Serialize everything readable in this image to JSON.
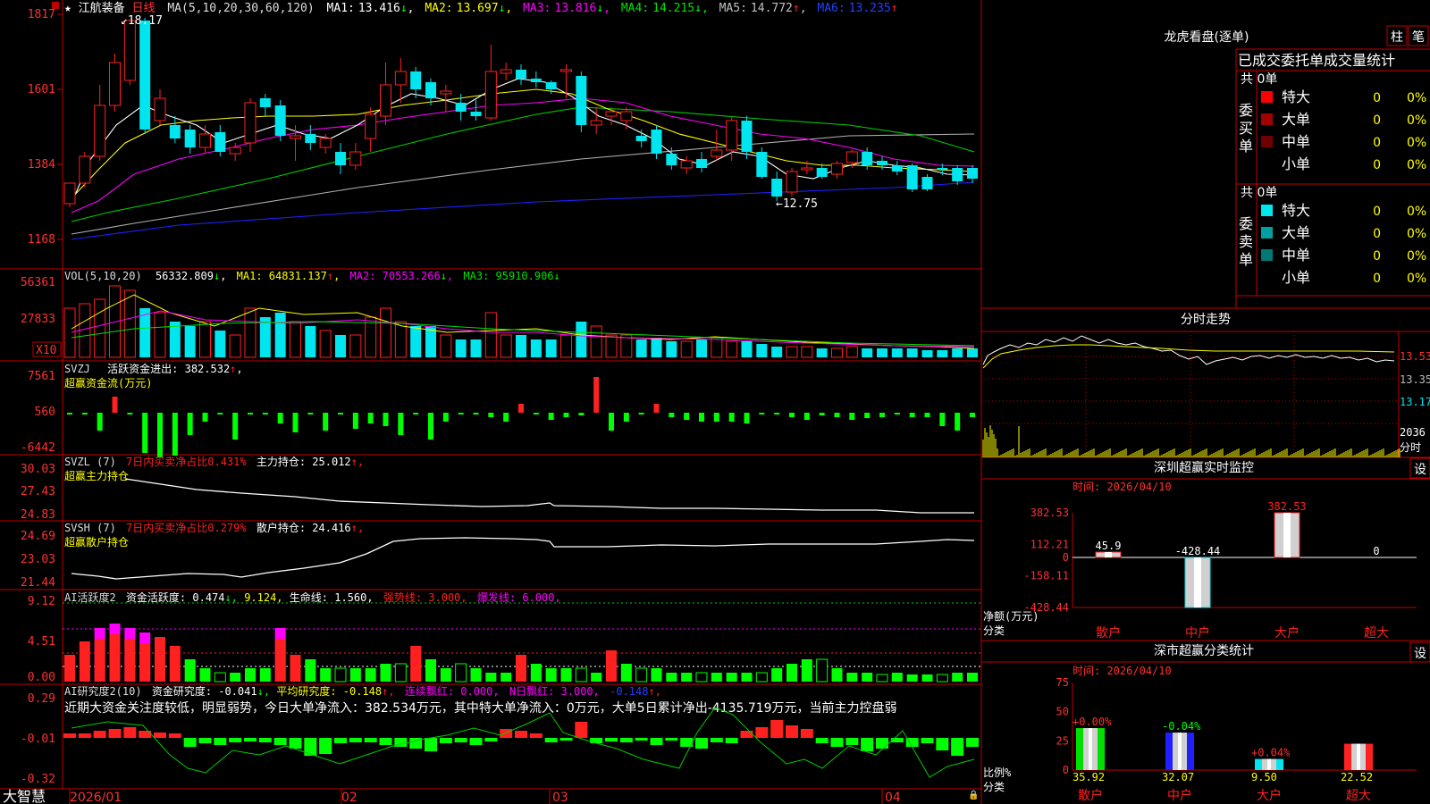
{
  "colors": {
    "up": "#ff2020",
    "down": "#00e5ee",
    "grid": "#c00000",
    "ma1": "#ffffff",
    "ma2": "#ffff00",
    "ma3": "#ff00ff",
    "ma4": "#00e000",
    "ma5": "#c0c0c0",
    "ma6": "#2020ff",
    "green": "#00ff00"
  },
  "stock": {
    "star": "★",
    "name": "江航装备",
    "period": "日线",
    "ma_params": "MA(5,10,20,30,60,120)",
    "ma": [
      {
        "label": "MA1:",
        "value": "13.416",
        "arrow": "↓"
      },
      {
        "label": "MA2:",
        "value": "13.697",
        "arrow": "↓"
      },
      {
        "label": "MA3:",
        "value": "13.816",
        "arrow": "↓"
      },
      {
        "label": "MA4:",
        "value": "14.215",
        "arrow": "↓"
      },
      {
        "label": "MA5:",
        "value": "14.772",
        "arrow": "↑"
      },
      {
        "label": "MA6:",
        "value": "13.235",
        "arrow": "↑"
      }
    ],
    "high_label": "18.17",
    "low_label": "12.75"
  },
  "price_axis": [
    "1817",
    "1601",
    "1384",
    "1168"
  ],
  "vol": {
    "title": "VOL(5,10,20)",
    "value": "56332.809",
    "arrow": "↓",
    "ma1": "MA1: 64831.137",
    "ma1_arrow": "↑",
    "ma2": "MA2: 70553.266",
    "ma2_arrow": "↓",
    "ma3": "MA3: 95910.906",
    "ma3_arrow": "↓",
    "axis": [
      "56361",
      "27833"
    ],
    "unit": "X10"
  },
  "svzj": {
    "title": "SVZJ",
    "label": "活跃资金进出: 382.532",
    "arrow": "↑",
    "sub": "超赢资金流(万元)",
    "axis": [
      "7561",
      "560",
      "-6442"
    ]
  },
  "svzl": {
    "title": "SVZL (7)",
    "ratio": "7日内买卖净占比0.431%",
    "label": "主力持仓: 25.012",
    "arrow": "↑,",
    "sub": "超赢主力持仓",
    "axis": [
      "30.03",
      "27.43",
      "24.83"
    ]
  },
  "svsh": {
    "title": "SVSH (7)",
    "ratio": "7日内买卖净占比0.279%",
    "label": "散户持仓: 24.416",
    "arrow": "↑,",
    "sub": "超赢散户持仓",
    "axis": [
      "24.69",
      "23.03",
      "21.44"
    ]
  },
  "ai1": {
    "title": "AI活跃度2",
    "label": "资金活跃度: 0.474",
    "arrow": "↓,",
    "v2": "9.124,",
    "life": "生命线: 1.560,",
    "strong": "强势线: 3.000,",
    "burst": "爆发线: 6.000,",
    "axis": [
      "9.12",
      "4.51",
      "0.00"
    ]
  },
  "ai2": {
    "title": "AI研究度2(10)",
    "label": "资金研究度: -0.041",
    "arrow": "↓,",
    "avg": "平均研究度: -0.148",
    "avg_arrow": "↑,",
    "red": "连续飘红: 0.000,",
    "nred": "N日飘红: 3.000,",
    "v": "-0.148",
    "v_arrow": "↑,",
    "comment": "近期大资金关注度较低，明显弱势，今日大单净流入：382.534万元，其中特大单净流入：0万元，大单5日累计净出-4135.719万元，当前主力控盘弱",
    "axis": [
      "0.29",
      "-0.01",
      "-0.32"
    ]
  },
  "dates": [
    "2026/01",
    "02",
    "03",
    "04"
  ],
  "brand": "大智慧",
  "right": {
    "dragon": {
      "title": "龙虎看盘(逐单)",
      "btn1": "柱",
      "btn2": "笔",
      "header": "已成交委托单成交量统计",
      "buy": {
        "side": "委买单",
        "total": "共 0单",
        "rows": [
          {
            "name": "特大",
            "qty": "0",
            "pct": "0%",
            "color": "#ff0000"
          },
          {
            "name": "大单",
            "qty": "0",
            "pct": "0%",
            "color": "#a00000"
          },
          {
            "name": "中单",
            "qty": "0",
            "pct": "0%",
            "color": "#700000"
          },
          {
            "name": "小单",
            "qty": "0",
            "pct": "0%",
            "color": "#000000"
          }
        ]
      },
      "sell": {
        "side": "委卖单",
        "total": "共 0单",
        "rows": [
          {
            "name": "特大",
            "qty": "0",
            "pct": "0%",
            "color": "#00e5ee"
          },
          {
            "name": "大单",
            "qty": "0",
            "pct": "0%",
            "color": "#00a0a0"
          },
          {
            "name": "中单",
            "qty": "0",
            "pct": "0%",
            "color": "#007878"
          },
          {
            "name": "小单",
            "qty": "0",
            "pct": "0%",
            "color": "#000000"
          }
        ]
      }
    },
    "intraday": {
      "title": "分时走势",
      "axis": [
        "13.53",
        "13.35",
        "13.17"
      ],
      "vol_axis": [
        "2036",
        "分时"
      ]
    },
    "monitor": {
      "title": "深圳超赢实时监控",
      "btn": "设",
      "time": "时间: 2026/04/10",
      "axis": [
        "382.53",
        "112.21",
        "0",
        "-158.11",
        "-428.44"
      ],
      "ylabel": "净额(万元)",
      "xlabel": "分类",
      "bars": [
        {
          "cat": "散户",
          "label": "45.9",
          "value": 45.9
        },
        {
          "cat": "中户",
          "label": "-428.44",
          "value": -428.44
        },
        {
          "cat": "大户",
          "label": "382.53",
          "value": 382.53
        },
        {
          "cat": "超大",
          "label": "0",
          "value": 0
        }
      ]
    },
    "classify": {
      "title": "深市超赢分类统计",
      "btn": "设",
      "time": "时间: 2026/04/10",
      "axis": [
        "75",
        "50",
        "25",
        "0"
      ],
      "ylabel": "比例%",
      "xlabel": "分类",
      "bars": [
        {
          "cat": "散户",
          "value": 35.92,
          "top": "+0.00%",
          "bottom": "35.92"
        },
        {
          "cat": "中户",
          "value": 32.07,
          "top": "-0.04%",
          "bottom": "32.07"
        },
        {
          "cat": "大户",
          "value": 9.5,
          "top": "+0.04%",
          "bottom": "9.50"
        },
        {
          "cat": "超大",
          "value": 22.52,
          "top": "",
          "bottom": "22.52"
        }
      ]
    }
  }
}
